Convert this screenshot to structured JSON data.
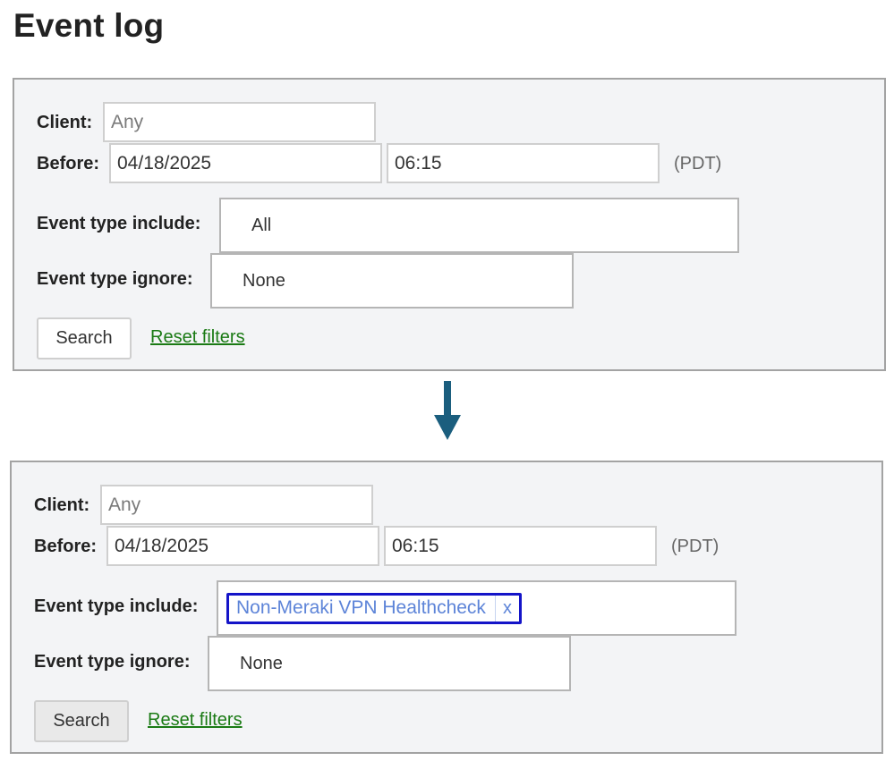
{
  "page": {
    "title": "Event log"
  },
  "labels": {
    "client": "Client:",
    "before": "Before:",
    "event_type_include": "Event type include:",
    "event_type_ignore": "Event type ignore:"
  },
  "panel_before": {
    "client_placeholder": "Any",
    "date": "04/18/2025",
    "time": "06:15",
    "timezone": "(PDT)",
    "event_type_include_value": "All",
    "event_type_ignore_value": "None",
    "search_label": "Search",
    "reset_label": "Reset filters"
  },
  "panel_after": {
    "client_placeholder": "Any",
    "date": "04/18/2025",
    "time": "06:15",
    "timezone": "(PDT)",
    "include_tag_label": "Non-Meraki VPN Healthcheck",
    "include_tag_remove": "x",
    "event_type_ignore_value": "None",
    "search_label": "Search",
    "reset_label": "Reset filters"
  },
  "colors": {
    "arrow": "#1b5e7e",
    "panel_bg": "#f3f4f6",
    "link": "#1a7a14",
    "tag_border": "#1414c8",
    "tag_text": "#5d84d8"
  },
  "icons": {
    "transition": "arrow-down-icon"
  }
}
